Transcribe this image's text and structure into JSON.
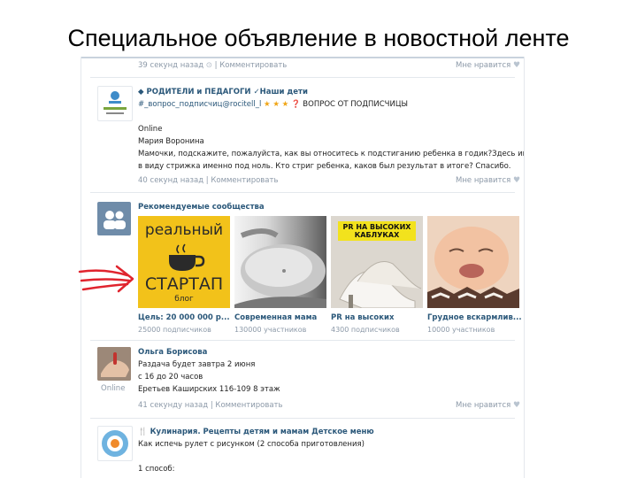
{
  "slide_title": "Специальное объявление в новостной ленте",
  "post1": {
    "time": "39 секунд назад",
    "separator": "|",
    "comment": "Комментировать",
    "like": "Мне нравится"
  },
  "post2": {
    "group": "РОДИТЕЛИ и ПЕДАГОГИ ✓Наши дети",
    "hashtag": "#_вопрос_подписчиц@rocitell_l",
    "question_label": "ВОПРОС ОТ ПОДПИСЧИЦЫ",
    "online": "Online",
    "author": "Мария Воронина",
    "text_line1": "Мамочки, подскажите, пожалуйста, как вы относитесь к подстиганию ребенка в годик?Здесь имеется",
    "text_line2": "в виду стрижка именно под ноль. Кто стриг ребенка, каков был результат в итоге? Спасибо.",
    "time": "40 секунд назад",
    "separator": "|",
    "comment": "Комментировать",
    "like": "Мне нравится"
  },
  "recommended": {
    "heading": "Рекомендуемые сообщества",
    "communities": [
      {
        "name": "Цель: 20 000 000 р...",
        "members": "25000 подписчиков",
        "image_text_top": "реальный",
        "image_text_main": "СТАРТАП",
        "image_text_sub": "блог"
      },
      {
        "name": "Современная мама",
        "members": "130000 участников"
      },
      {
        "name": "PR на высоких",
        "members": "4300 подписчиков",
        "image_text_line1": "PR НА ВЫСОКИХ",
        "image_text_line2": "КАБЛУКАХ"
      },
      {
        "name": "Грудное вскармлив...",
        "members": "10000 участников"
      }
    ]
  },
  "post3": {
    "author": "Ольга Борисова",
    "line1": "Раздача будет завтра 2 июня",
    "line2": "с 16 до 20 часов",
    "line3": "Еретьев Каширских 116-109 8 этаж",
    "online": "Online",
    "time": "41 секунду назад",
    "separator": "|",
    "comment": "Комментировать",
    "like": "Мне нравится"
  },
  "post4": {
    "group": "Кулинария. Рецепты детям и мамам Детское меню",
    "line1": "Как испечь рулет с рисунком (2 способа приготовления)",
    "line2": "1 способ:"
  },
  "colors": {
    "link": "#2b587a",
    "muted": "#8c99a8",
    "arrow": "#e0242e",
    "startup_yellow": "#f2c21a"
  }
}
